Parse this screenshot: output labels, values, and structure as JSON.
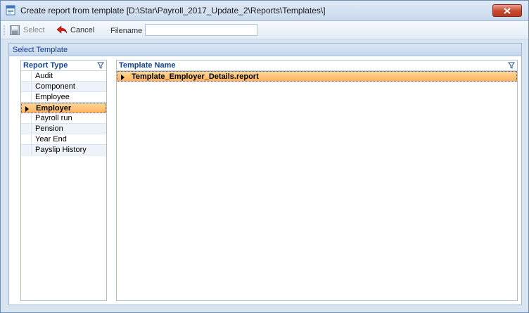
{
  "window": {
    "title": "Create report from template [D:\\Star\\Payroll_2017_Update_2\\Reports\\Templates\\]"
  },
  "toolbar": {
    "select_label": "Select",
    "cancel_label": "Cancel",
    "filename_label": "Filename :",
    "filename_value": ""
  },
  "panel": {
    "title": "Select Template"
  },
  "report_types": {
    "header": "Report Type",
    "items": [
      "Audit",
      "Component",
      "Employee",
      "Employer",
      "Payroll run",
      "Pension",
      "Year End",
      "Payslip History"
    ],
    "selected": "Employer"
  },
  "templates": {
    "header": "Template Name",
    "items": [
      "Template_Employer_Details.report"
    ],
    "selected": "Template_Employer_Details.report"
  },
  "colors": {
    "accent": "#15428b",
    "selection": "#ffb25a",
    "close_button": "#c5482f"
  },
  "icons": {
    "app": "report-template-icon",
    "select": "save-disk-icon",
    "cancel": "back-arrow-icon",
    "filter": "filter-funnel-icon",
    "close": "close-icon",
    "row_indicator": "current-row-arrow-icon"
  }
}
